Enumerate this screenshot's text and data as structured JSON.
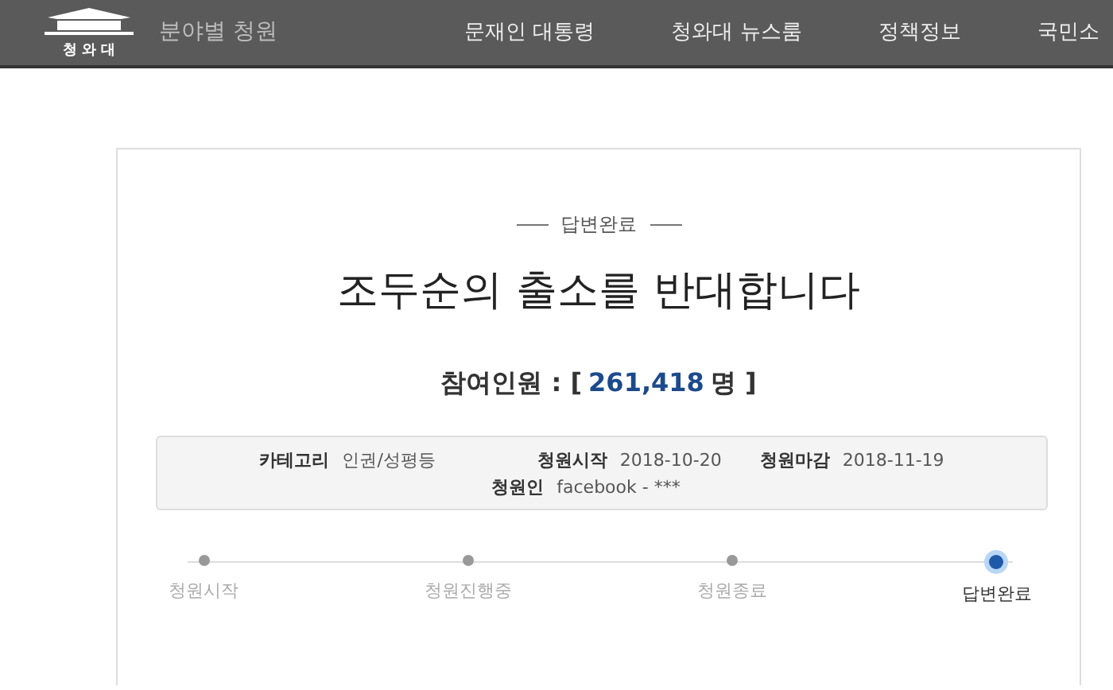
{
  "header": {
    "logo_text": "청 와 대",
    "section": "분야별 청원",
    "nav": [
      "문재인 대통령",
      "청와대 뉴스룸",
      "정책정보",
      "국민소"
    ]
  },
  "petition": {
    "status": "답변완료",
    "title": "조두순의 출소를 반대합니다",
    "count_label": "참여인원 : [",
    "count": "261,418",
    "count_unit": "명 ]",
    "info": [
      {
        "label": "카테고리",
        "value": "인권/성평등"
      },
      {
        "label": "청원시작",
        "value": "2018-10-20"
      },
      {
        "label": "청원마감",
        "value": "2018-11-19"
      },
      {
        "label": "청원인",
        "value": "facebook - ***"
      }
    ],
    "steps": [
      {
        "label": "청원시작",
        "selected": false
      },
      {
        "label": "청원진행중",
        "selected": false
      },
      {
        "label": "청원종료",
        "selected": false
      },
      {
        "label": "답변완료",
        "selected": true
      }
    ]
  }
}
